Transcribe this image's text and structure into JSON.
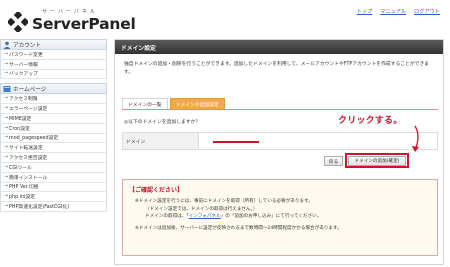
{
  "header": {
    "logo_small": "サーバーパネル",
    "logo_big": "ServerPanel",
    "links": [
      "トップ",
      "マニュアル",
      "ログアウト"
    ]
  },
  "sidebar": {
    "sections": [
      {
        "title": "アカウント",
        "items": [
          "パスワード変更",
          "サーバー情報",
          "バックアップ"
        ]
      },
      {
        "title": "ホームページ",
        "items": [
          "アクセス制限",
          "エラーページ設定",
          "MIME設定",
          "Cron設定",
          "mod_pagespeed設定",
          "サイト転送設定",
          "アクセス拒否設定",
          "CGIツール",
          "簡単インストール",
          "PHP Ver.切替",
          "php.ini設定",
          "PHP高速化設定(FastCGI化)"
        ]
      }
    ]
  },
  "panel": {
    "title": "ドメイン設定",
    "description": "独自ドメインの追加・削除を行うことができます。追加したドメインを利用して、メールアカウントやFTPアカウントを作成することができます。",
    "tabs": [
      "ドメインの一覧",
      "ドメインの追加設定"
    ],
    "active_tab": 1,
    "question": "◎以下のドメインを追加しますか？",
    "form_label": "ドメイン",
    "annotation": "クリックする。",
    "back_button": "戻る",
    "add_button": "ドメインの追加(確定)",
    "notice": {
      "title": "【ご確認ください】",
      "line1": "※ドメイン設定を行うには、事前にドメインを取得（所有）している必要があります。",
      "line2": "（ドメイン設定では、ドメインの取得は行えません。）",
      "line3_pre": "ドメインの取得は、「",
      "line3_link": "インフォパネル",
      "line3_post": "」の「追加のお申し込み」にて行ってください。",
      "line4": "※ドメインは追加後、サーバーに設定が反映されるまで数時間〜24時間程度かかる場合があります。"
    }
  },
  "colors": {
    "accent_orange": "#f3a847",
    "annotation_red": "#d0132b",
    "link_blue": "#2f62b8"
  }
}
